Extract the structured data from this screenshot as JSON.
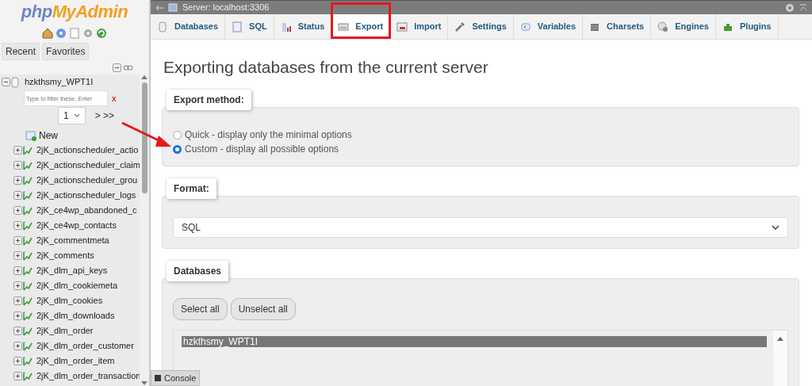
{
  "logo": {
    "prefix": "php",
    "name": "MyAdmin"
  },
  "sidebar_tabs": [
    "Recent",
    "Favorites"
  ],
  "tree": {
    "database": {
      "name": "hzkthsmy_WPT1I",
      "expanded": true
    },
    "filter": {
      "placeholder": "Type to filter these, Enter",
      "clear": "x"
    },
    "page": {
      "value": "1",
      "nav": "> >>"
    },
    "new_item": "New",
    "tables": [
      {
        "name": "2jK_actionscheduler_actio",
        "expanded": false
      },
      {
        "name": "2jK_actionscheduler_claim",
        "expanded": false
      },
      {
        "name": "2jK_actionscheduler_grou",
        "expanded": false
      },
      {
        "name": "2jK_actionscheduler_logs",
        "expanded": false
      },
      {
        "name": "2jK_ce4wp_abandoned_c",
        "expanded": false
      },
      {
        "name": "2jK_ce4wp_contacts",
        "expanded": false
      },
      {
        "name": "2jK_commentmeta",
        "expanded": false
      },
      {
        "name": "2jK_comments",
        "expanded": false
      },
      {
        "name": "2jK_dlm_api_keys",
        "expanded": false
      },
      {
        "name": "2jK_dlm_cookiemeta",
        "expanded": false
      },
      {
        "name": "2jK_dlm_cookies",
        "expanded": false
      },
      {
        "name": "2jK_dlm_downloads",
        "expanded": false
      },
      {
        "name": "2jK_dlm_order",
        "expanded": false
      },
      {
        "name": "2jK_dlm_order_customer",
        "expanded": false
      },
      {
        "name": "2jK_dlm_order_item",
        "expanded": false
      },
      {
        "name": "2jK_dlm_order_transaction",
        "expanded": false
      }
    ]
  },
  "server_bar": {
    "breadcrumb": "Server: localhost:3306"
  },
  "tabs": [
    {
      "label": "Databases",
      "selected": false
    },
    {
      "label": "SQL",
      "selected": false
    },
    {
      "label": "Status",
      "selected": false
    },
    {
      "label": "Export",
      "selected": true
    },
    {
      "label": "Import",
      "selected": false
    },
    {
      "label": "Settings",
      "selected": false
    },
    {
      "label": "Variables",
      "selected": false
    },
    {
      "label": "Charsets",
      "selected": false
    },
    {
      "label": "Engines",
      "selected": false
    },
    {
      "label": "Plugins",
      "selected": false
    }
  ],
  "heading": "Exporting databases from the current server",
  "export_method": {
    "legend": "Export method:",
    "options": [
      {
        "label": "Quick - display only the minimal options",
        "selected": false
      },
      {
        "label": "Custom - display all possible options",
        "selected": true
      }
    ]
  },
  "format": {
    "legend": "Format:",
    "value": "SQL"
  },
  "databases": {
    "legend": "Databases",
    "buttons": [
      "Select all",
      "Unselect all"
    ],
    "items": [
      {
        "name": "hzkthsmy_WPT1I",
        "selected": true
      }
    ]
  },
  "console": {
    "label": "Console"
  }
}
